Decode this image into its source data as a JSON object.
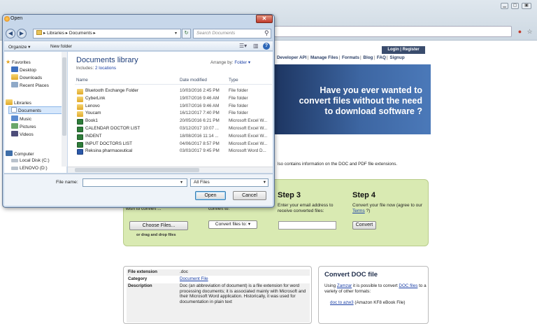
{
  "dialog": {
    "title": "Open",
    "close_glyph": "✕",
    "breadcrumb": "▸ Libraries ▸ Documents ▸",
    "search_placeholder": "Search Documents",
    "toolbar": {
      "organize": "Organize ▾",
      "new_folder": "New folder"
    },
    "library_title": "Documents library",
    "library_includes_label": "Includes:",
    "library_includes_link": "2 locations",
    "arrange_label": "Arrange by:",
    "arrange_value": "Folder ▾",
    "columns": {
      "name": "Name",
      "date": "Date modified",
      "type": "Type"
    },
    "files": [
      {
        "name": "Bluetooth Exchange Folder",
        "date": "10/03/2016 2:45 PM",
        "type": "File folder",
        "kind": "folder"
      },
      {
        "name": "CyberLink",
        "date": "19/07/2016 9:46 AM",
        "type": "File folder",
        "kind": "folder"
      },
      {
        "name": "Lenovo",
        "date": "19/07/2016 9:46 AM",
        "type": "File folder",
        "kind": "folder"
      },
      {
        "name": "Youcam",
        "date": "16/12/2017 7:40 PM",
        "type": "File folder",
        "kind": "folder"
      },
      {
        "name": "Book1",
        "date": "20/05/2016 6:21 PM",
        "type": "Microsoft Excel W...",
        "kind": "xls"
      },
      {
        "name": "CALENDAR DOCTOR LIST",
        "date": "03/12/2017 10:07 ...",
        "type": "Microsoft Excel W...",
        "kind": "xls"
      },
      {
        "name": "INDENT",
        "date": "18/08/2016 11:14 ...",
        "type": "Microsoft Excel W...",
        "kind": "xls"
      },
      {
        "name": "INPUT DOCTORS LIST",
        "date": "04/06/2017 8:57 PM",
        "type": "Microsoft Excel W...",
        "kind": "xls"
      },
      {
        "name": "Reksina pharmaceutical",
        "date": "03/03/2017 9:45 PM",
        "type": "Microsoft Word D...",
        "kind": "doc"
      }
    ],
    "nav": {
      "favorites": "Favorites",
      "favorites_items": [
        "Desktop",
        "Downloads",
        "Recent Places"
      ],
      "libraries": "Libraries",
      "libraries_items": [
        "Documents",
        "Music",
        "Pictures",
        "Videos"
      ],
      "computer": "Computer",
      "computer_items": [
        "Local Disk (C:)",
        "LENOVO (D:)"
      ]
    },
    "filename_label": "File name:",
    "filename_value": "",
    "filter_value": "All Files",
    "open_label": "Open",
    "cancel_label": "Cancel"
  },
  "site": {
    "login": "Login | Register",
    "nav": [
      "Developer API",
      "Manage Files",
      "Formats",
      "Blog",
      "FAQ",
      "Signup"
    ],
    "banner_lines": [
      "Have you ever wanted to",
      "convert files without the need",
      "to download software ?"
    ],
    "intro": "lso contains information on the DOC and PDF file extensions.",
    "step1_text": "wish to convert ...",
    "choose_files": "Choose Files...",
    "drag_drop": "or drag and drop files",
    "step2_text": "convert to:",
    "convert_select": "Convert files to: ▾",
    "step3_title": "Step 3",
    "step3_text": "Enter your email address to receive converted files:",
    "step4_title": "Step 4",
    "step4_text_pre": "Convert your file now (agree to our",
    "step4_terms": "Terms",
    "step4_text_post": "?)",
    "convert_button": "Convert",
    "fileinfo": {
      "ext_label": "File extension",
      "ext_value": ".doc",
      "cat_label": "Category",
      "cat_value": "Document File",
      "desc_label": "Description",
      "desc_value": "Doc (an abbreviation of document) is a file extension for word processing documents; it is associated mainly with Microsoft and their Microsoft Word application. Historically, it was used for documentation in plain text"
    },
    "convbox": {
      "title": "Convert DOC file",
      "text_pre": "Using",
      "zamzar": "Zamzar",
      "text_mid": "it is possible to convert",
      "doc_files": "DOC files",
      "text_post": "to a variety of other formats:",
      "link1": "doc to azw3",
      "link1_desc": "(Amazon KF8 eBook File)"
    }
  },
  "colors": {
    "dialog_frame": "#c7d7ea",
    "banner": "#3d66a2",
    "steps_bg": "#d9eab2",
    "close_red": "#c0392b"
  }
}
